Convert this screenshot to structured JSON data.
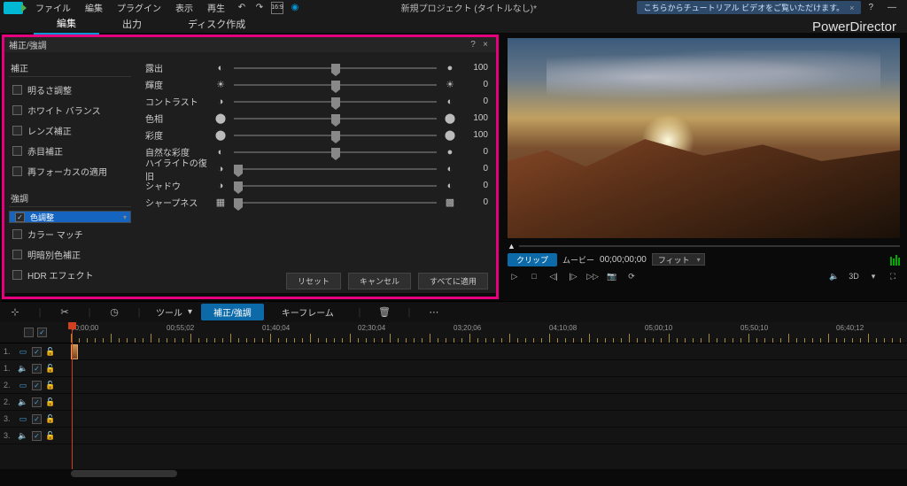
{
  "menu": {
    "items": [
      "ファイル",
      "編集",
      "プラグイン",
      "表示",
      "再生"
    ]
  },
  "project_title": "新規プロジェクト (タイトルなし)*",
  "tutorial_banner": "こちらからチュートリアル ビデオをご覧いただけます。",
  "brand": "PowerDirector",
  "tabs": {
    "edit": "編集",
    "output": "出力",
    "disc": "ディスク作成"
  },
  "panel": {
    "title": "補正/強調",
    "group1": "補正",
    "group2": "強調",
    "fix_items": [
      "明るさ調整",
      "ホワイト バランス",
      "レンズ補正",
      "赤目補正",
      "再フォーカスの適用"
    ],
    "enh_items": [
      "色調整",
      "カラー マッチ",
      "明暗別色補正",
      "HDR エフェクト"
    ],
    "sliders": [
      {
        "label": "露出",
        "icon1": "◐",
        "icon2": "●",
        "value": "100",
        "pos": 50
      },
      {
        "label": "輝度",
        "icon1": "☀",
        "icon2": "☀",
        "value": "0",
        "pos": 50
      },
      {
        "label": "コントラスト",
        "icon1": "◑",
        "icon2": "◐",
        "value": "0",
        "pos": 50
      },
      {
        "label": "色相",
        "icon1": "⬤",
        "icon2": "⬤",
        "value": "100",
        "pos": 50
      },
      {
        "label": "彩度",
        "icon1": "⬤",
        "icon2": "⬤",
        "value": "100",
        "pos": 50
      },
      {
        "label": "自然な彩度",
        "icon1": "◐",
        "icon2": "●",
        "value": "0",
        "pos": 50
      },
      {
        "label": "ハイライトの復旧",
        "icon1": "◑",
        "icon2": "◐",
        "value": "0",
        "pos": 2
      },
      {
        "label": "シャドウ",
        "icon1": "◑",
        "icon2": "◐",
        "value": "0",
        "pos": 2
      },
      {
        "label": "シャープネス",
        "icon1": "▦",
        "icon2": "▩",
        "value": "0",
        "pos": 2
      }
    ],
    "buttons": {
      "reset": "リセット",
      "cancel": "キャンセル",
      "apply": "すべてに適用"
    }
  },
  "preview": {
    "clip": "クリップ",
    "movie": "ムービー",
    "timecode": "00;00;00;00",
    "fit": "フィット",
    "vol": "🔈",
    "threeD": "3D",
    "full": "⛶"
  },
  "toolbar": {
    "tool": "ツール",
    "fix": "補正/強調",
    "keyframe": "キーフレーム"
  },
  "ruler_ticks": [
    "00;00;00",
    "00;55;02",
    "01;40;04",
    "02;30;04",
    "03;20;06",
    "04;10;08",
    "05;00;10",
    "05;50;10",
    "06;40;12"
  ]
}
